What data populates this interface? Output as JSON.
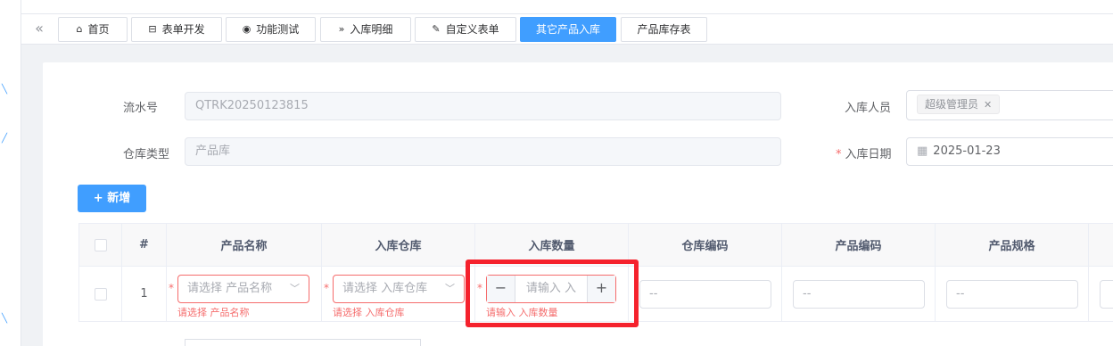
{
  "tabs": [
    {
      "icon": "home-icon",
      "glyph": "⌂",
      "label": "首页",
      "active": false
    },
    {
      "icon": "form-icon",
      "glyph": "⊟",
      "label": "表单开发",
      "active": false
    },
    {
      "icon": "eye-icon",
      "glyph": "◉",
      "label": "功能测试",
      "active": false
    },
    {
      "icon": "double-chevron-right-icon",
      "glyph": "»",
      "label": "入库明细",
      "active": false
    },
    {
      "icon": "edit-icon",
      "glyph": "✎",
      "label": "自定义表单",
      "active": false
    },
    {
      "icon": "",
      "glyph": "",
      "label": "其它产品入库",
      "active": true
    },
    {
      "icon": "",
      "glyph": "",
      "label": "产品库存表",
      "active": false
    }
  ],
  "form": {
    "serial_label": "流水号",
    "serial_value": "QTRK20250123815",
    "warehouse_type_label": "仓库类型",
    "warehouse_type_value": "产品库",
    "operator_label": "入库人员",
    "operator_tag": "超级管理员",
    "date_label": "入库日期",
    "date_value": "2025-01-23"
  },
  "add_button_label": "+ 新增",
  "table": {
    "headers": [
      "",
      "#",
      "产品名称",
      "入库仓库",
      "入库数量",
      "仓库编码",
      "产品编码",
      "产品规格"
    ],
    "row": {
      "index": "1",
      "product_placeholder": "请选择 产品名称",
      "product_error": "请选择 产品名称",
      "warehouse_placeholder": "请选择 入库仓库",
      "warehouse_error": "请选择 入库仓库",
      "qty_placeholder": "请输入 入",
      "qty_error": "请输入 入库数量",
      "warehouse_code": "--",
      "product_code": "--",
      "product_spec": "--"
    }
  },
  "colors": {
    "primary": "#409eff",
    "error": "#f56c6c",
    "highlight": "#f5222d"
  }
}
